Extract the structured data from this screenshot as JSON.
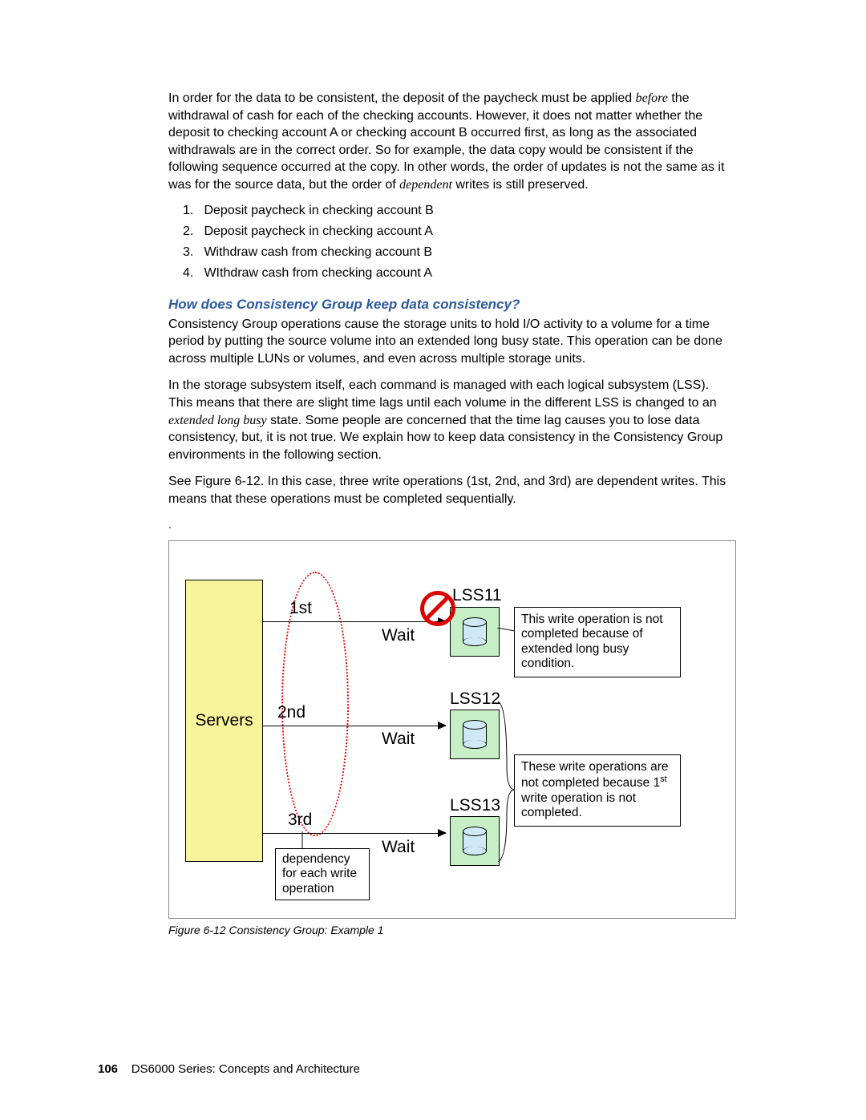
{
  "intro": {
    "p1a": "In order for the data to be consistent, the deposit of the paycheck must be applied ",
    "emph1": "before",
    "p1b": " the withdrawal of cash for each of the checking accounts. However, it does not matter whether the deposit to checking account A or checking account B occurred first, as long as the associated withdrawals are in the correct order. So for example, the data copy would be consistent if the following sequence occurred at the copy. In other words, the order of updates is not the same as it was for the source data, but the order of ",
    "emph2": "dependent",
    "p1c": " writes is still preserved."
  },
  "list": {
    "n1": "1.",
    "i1": "Deposit paycheck in checking account B",
    "n2": "2.",
    "i2": "Deposit paycheck in checking account A",
    "n3": "3.",
    "i3": "Withdraw cash from checking account B",
    "n4": "4.",
    "i4": "WIthdraw cash from checking account A"
  },
  "heading": "How does Consistency Group keep data consistency?",
  "p2": "Consistency Group operations cause the storage units to hold I/O activity to a volume for a time period by putting the source volume into an extended long busy state. This operation can be done across multiple LUNs or volumes, and even across multiple storage units.",
  "p3a": "In the storage subsystem itself, each command is managed with each logical subsystem (LSS). This means that there are slight time lags until each volume in the different LSS is changed to an ",
  "emph3": "extended long busy",
  "p3b": " state. Some people are concerned that the time lag causes you to lose data consistency, but, it is not true. We explain how to keep data consistency in the Consistency Group environments in the following section.",
  "p4": "See Figure 6-12. In this case, three write operations (1st, 2nd, and 3rd) are dependent writes. This means that these operations must be completed sequentially.",
  "diagram": {
    "servers": "Servers",
    "ord1": "1st",
    "ord2": "2nd",
    "ord3": "3rd",
    "wait": "Wait",
    "lss11": "LSS11",
    "lss12": "LSS12",
    "lss13": "LSS13",
    "note1": "This write operation is not completed because of extended long busy condition.",
    "note2a": "These write operations are not completed because 1",
    "note2sup": "st",
    "note2b": " write operation is not completed.",
    "depnote": "dependency for each write operation"
  },
  "caption": "Figure 6-12   Consistency Group: Example 1",
  "footer": {
    "page": "106",
    "title": "DS6000 Series: Concepts and Architecture"
  }
}
